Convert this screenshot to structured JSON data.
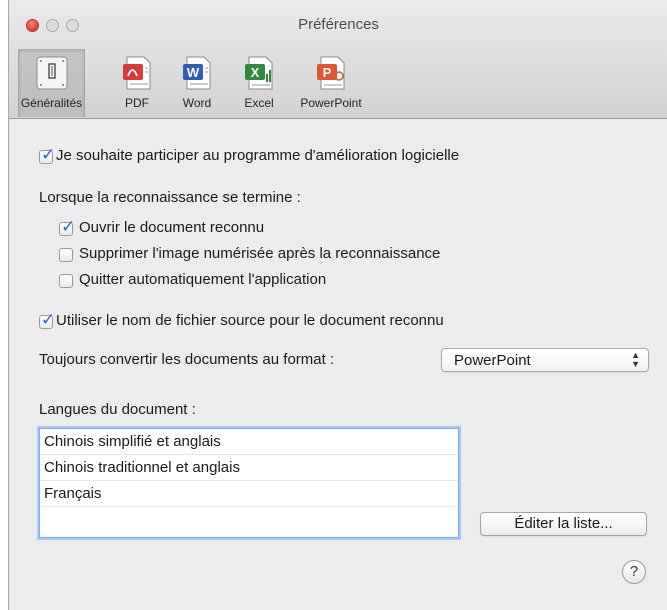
{
  "window": {
    "title": "Préférences"
  },
  "toolbar": {
    "items": [
      {
        "label": "Généralités",
        "icon": "general-settings-icon"
      },
      {
        "label": "PDF",
        "icon": "pdf-icon"
      },
      {
        "label": "Word",
        "icon": "word-icon"
      },
      {
        "label": "Excel",
        "icon": "excel-icon"
      },
      {
        "label": "PowerPoint",
        "icon": "powerpoint-icon"
      }
    ],
    "selected": "Généralités"
  },
  "options": {
    "participate": {
      "label": "Je souhaite participer au programme d'amélioration logicielle",
      "checked": true
    },
    "on_finish_label": "Lorsque la reconnaissance se termine :",
    "open_doc": {
      "label": "Ouvrir le document reconnu",
      "checked": true
    },
    "delete_image": {
      "label": "Supprimer l'image numérisée après la reconnaissance",
      "checked": false
    },
    "quit_app": {
      "label": "Quitter automatiquement l'application",
      "checked": false
    },
    "use_source_name": {
      "label": "Utiliser le nom de fichier source pour le document reconnu",
      "checked": true
    }
  },
  "format": {
    "label": "Toujours convertir les documents au format :",
    "selected": "PowerPoint"
  },
  "languages": {
    "label": "Langues du document :",
    "items": [
      "Chinois simplifié et anglais",
      "Chinois traditionnel et anglais",
      "Français"
    ],
    "edit_button": "Éditer la liste..."
  },
  "help": {
    "label": "?"
  },
  "colors": {
    "accent": "#2b62c6",
    "focus": "#7eaef5"
  }
}
